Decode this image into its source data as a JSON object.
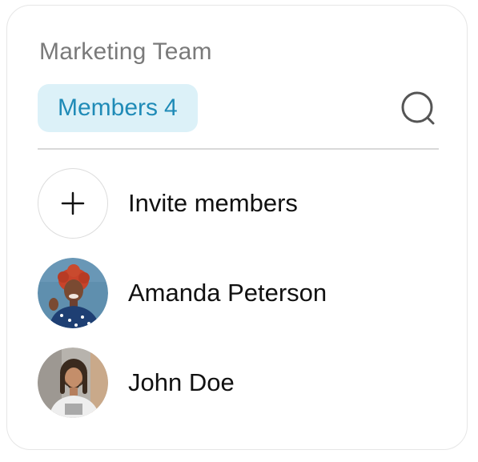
{
  "team": {
    "title": "Marketing Team"
  },
  "tab": {
    "label": "Members",
    "count": "4"
  },
  "invite": {
    "label": "Invite members"
  },
  "members": [
    {
      "name": "Amanda Peterson",
      "avatar": "photo-woman-red-curly-hair"
    },
    {
      "name": "John Doe",
      "avatar": "photo-man-dreadlocks"
    }
  ],
  "colors": {
    "badge_bg": "#dcf1f8",
    "badge_text": "#1f8bb7",
    "title_text": "#7a7a7a"
  }
}
